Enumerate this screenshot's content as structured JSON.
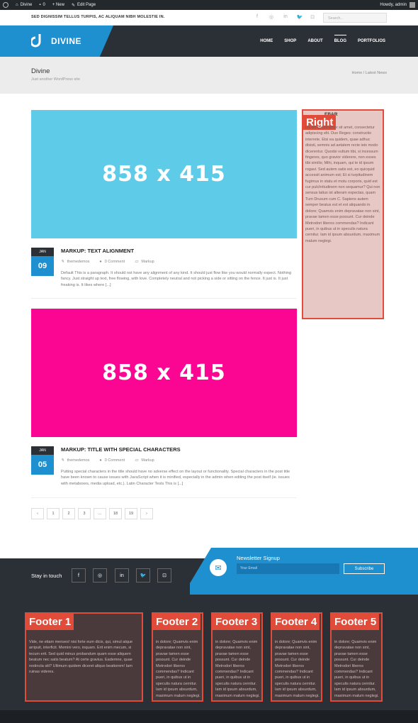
{
  "adminbar": {
    "site": "Divine",
    "comments": "0",
    "new": "+ New",
    "edit": "Edit Page",
    "howdy": "Howdy, admin"
  },
  "topbar": {
    "tagline": "SED DIGNISSIM TELLUS TURPIS, AC ALIQUAM NIBH MOLESTIE IN.",
    "social": [
      "f",
      "◎",
      "in",
      "🐦",
      "⊡"
    ],
    "search_placeholder": "Search..."
  },
  "header": {
    "logo": "DIVINE",
    "nav": [
      "HOME",
      "SHOP",
      "ABOUT",
      "BLOG",
      "PORTFOLIOS"
    ],
    "active": "BLOG",
    "brand_color": "#1e8fcf",
    "dark_color": "#2b2f36"
  },
  "page": {
    "title": "Divine",
    "subtitle": "Just another WordPress site",
    "breadcrumb": "Home / Latest News"
  },
  "posts": [
    {
      "image_label": "858 x 415",
      "image_color": "#5ecbe9",
      "month": "JAN",
      "day": "09",
      "title": "MARKUP: TEXT ALIGNMENT",
      "author": "themedemos",
      "comments": "0 Comment",
      "category": "Markup",
      "excerpt": "Default This is a paragraph. It should not have any alignment of any kind. It should just flow like you would normally expect. Nothing fancy. Just straight up text, free flowing, with love. Completely neutral and not picking a side or sitting on the fence. It just is. It just freaking is. It likes where [...]"
    },
    {
      "image_label": "858 x 415",
      "image_color": "#fa0692",
      "month": "JAN",
      "day": "05",
      "title": "MARKUP: TITLE WITH SPECIAL CHARACTERS",
      "author": "themedemos",
      "comments": "0 Comment",
      "category": "Markup",
      "excerpt": "Putting special characters in the title should have no adverse effect on the layout or functionality. Special characters in the post title have been known to cause issues with JavaScript when it is minified, especially in the admin when editing the post itself (ie. issues with metaboxes, media upload, etc.). Latin Character Tests This is [...]"
    }
  ],
  "pagination": [
    "‹",
    "1",
    "2",
    "3",
    "...",
    "18",
    "19",
    "›"
  ],
  "sidebar": {
    "label": "Right",
    "heading": "EBAR",
    "text": "Lorem ipsum dolor sit amet, consectetur adipiscing elit. Duo Reges: constructio interrete. Etsi ea quidem, quae adhuc dixisti, semnis ad aetatem recte isto modo dicerentur. Quodsi vultum tibi, si incessum fingeres, quo gravior viderere, non esses tibi similis; Mihi, inquam, qui te id ipsum rogavi. Sed autem satis est, eo quicquid accessit animum est; Et si turpitudinem fugimus in statu et motu corporis, quid est cur pulchritudinem non sequamur? Qui non sensus latius ist alteram expectas, quam Tum Drusum cum C. Sapiens autem semper beatus est et est aliquando in dolore; Quamvis enim depravatae non sint, pravae tamen esse possunt. Cur deinde Metrodori liberos commendas? Indicant pueri, in quibus ut in speculis natura cernitur. Iam id ipsum absurdum, maximum malum neglegi."
  },
  "newsletter": {
    "stay": "Stay in touch",
    "social": [
      "f",
      "◎",
      "in",
      "🐦",
      "⊡"
    ],
    "title": "Newsletter Signup",
    "email_placeholder": "Your Email",
    "subscribe": "Subscribe"
  },
  "footer": [
    {
      "label": "Footer 1",
      "text": "Vide, ne etiam menses! nisi forte eum dicis, qui, simul atque arripuit, interficit. Memini vero, inquam. Erit enim mecum, si tecum erit. Sed quid minus probandum quam esse aliquem beatum nec satis beatum? At certe gravius. Eademne, quae restincta siti? Ultimum quidem diceret aliquo beatiorem! Iam ruinas videres."
    },
    {
      "label": "Footer 2",
      "text": "in dolore; Quamvis enim depravatae non sint, pravae tamen esse possunt. Cur deinde Metrodori liberos commendas? Indicant pueri, in quibus ut in speculis natura cernitur. Iam id ipsum absurdum, maximum malum neglegi."
    },
    {
      "label": "Footer 3",
      "text": "in dolore; Quamvis enim depravatae non sint, pravae tamen esse possunt. Cur deinde Metrodori liberos commendas? Indicant pueri, in quibus ut in speculis natura cernitur. Iam id ipsum absurdum, maximum malum neglegi."
    },
    {
      "label": "Footer 4",
      "text": "in dolore; Quamvis enim depravatae non sint, pravae tamen esse possunt. Cur deinde Metrodori liberos commendas? Indicant pueri, in quibus ut in speculis natura cernitur. Iam id ipsum absurdum, maximum malum neglegi."
    },
    {
      "label": "Footer 5",
      "text": "in dolore; Quamvis enim depravatae non sint, pravae tamen esse possunt. Cur deinde Metrodori liberos commendas? Indicant pueri, in quibus ut in speculis natura cernitur. Iam id ipsum absurdum, maximum malum neglegi."
    }
  ]
}
